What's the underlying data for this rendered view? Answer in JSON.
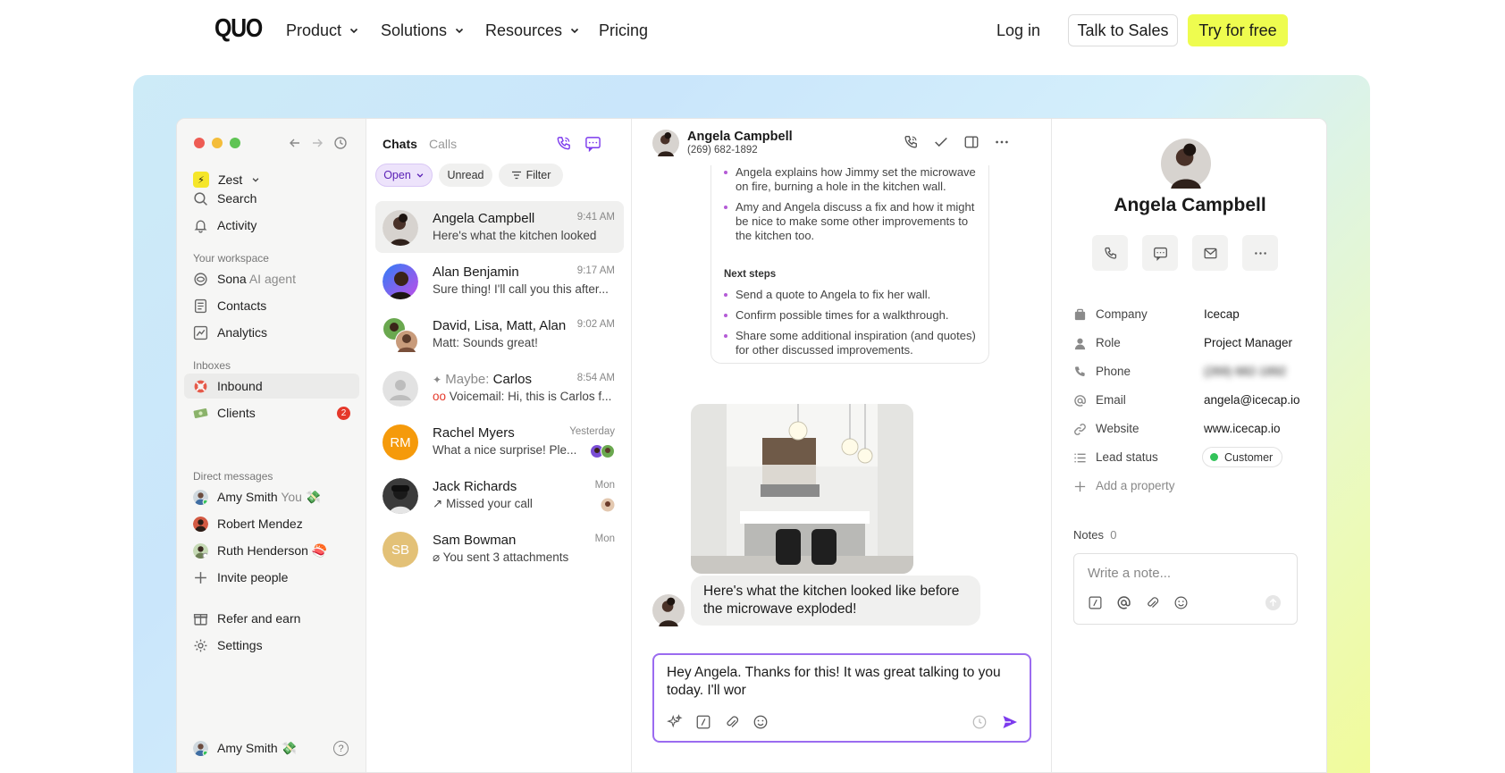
{
  "topnav": {
    "logo": "QUO",
    "items": [
      "Product",
      "Solutions",
      "Resources",
      "Pricing"
    ],
    "login": "Log in",
    "sales": "Talk to Sales",
    "try": "Try for free",
    "accent": "#eefc4f"
  },
  "sidebar": {
    "workspace": "Zest",
    "search": "Search",
    "activity": "Activity",
    "workspace_head": "Your workspace",
    "sona": "Sona",
    "sona_sub": "AI agent",
    "contacts": "Contacts",
    "analytics": "Analytics",
    "inboxes_head": "Inboxes",
    "inbound": "Inbound",
    "clients": "Clients",
    "clients_badge": "2",
    "dm_head": "Direct messages",
    "dms": [
      {
        "name": "Amy Smith",
        "suffix": "You"
      },
      {
        "name": "Robert Mendez"
      },
      {
        "name": "Ruth Henderson"
      }
    ],
    "invite": "Invite people",
    "refer": "Refer and earn",
    "settings": "Settings",
    "footer_user": "Amy Smith",
    "help": "?"
  },
  "chatlist": {
    "tabs": [
      "Chats",
      "Calls"
    ],
    "filters": [
      "Open",
      "Unread",
      "Filter"
    ],
    "items": [
      {
        "name": "Angela Campbell",
        "time": "9:41 AM",
        "preview": "Here's what the kitchen looked"
      },
      {
        "name": "Alan Benjamin",
        "time": "9:17 AM",
        "preview": "Sure thing! I'll call you this after..."
      },
      {
        "name": "David, Lisa, Matt, Alan",
        "time": "9:02 AM",
        "preview": "Matt: Sounds great!"
      },
      {
        "name_prefix": "Maybe:",
        "name": "Carlos",
        "time": "8:54 AM",
        "preview": "Voicemail: Hi, this is Carlos f..."
      },
      {
        "name": "Rachel Myers",
        "time": "Yesterday",
        "preview": "What a nice surprise! Ple...",
        "initials": "RM"
      },
      {
        "name": "Jack Richards",
        "time": "Mon",
        "preview": "Missed your call"
      },
      {
        "name": "Sam Bowman",
        "time": "Mon",
        "preview": "You sent 3 attachments",
        "initials": "SB"
      }
    ]
  },
  "conversation": {
    "contact_name": "Angela Campbell",
    "contact_phone": "(269) 682-1892",
    "summary_bullets": [
      "Angela explains how Jimmy set the microwave on fire, burning a hole in the kitchen wall.",
      "Amy and Angela discuss a fix and how it might be nice to make some other improvements to the kitchen too."
    ],
    "next_steps_head": "Next steps",
    "next_steps": [
      "Send a quote to Angela to fix her wall.",
      "Confirm possible times for a walkthrough.",
      "Share some additional inspiration (and quotes) for other discussed improvements."
    ],
    "message": "Here's what the kitchen looked like before the microwave exploded!",
    "draft": "Hey Angela. Thanks for this! It was great talking to you today. I'll wor"
  },
  "panel": {
    "name": "Angela Campbell",
    "properties": [
      {
        "label": "Company",
        "value": "Icecap",
        "icon": "building-icon"
      },
      {
        "label": "Role",
        "value": "Project Manager",
        "icon": "person-icon"
      },
      {
        "label": "Phone",
        "value": "(269) 682-1892",
        "icon": "phone-icon"
      },
      {
        "label": "Email",
        "value": "angela@icecap.io",
        "icon": "at-icon"
      },
      {
        "label": "Website",
        "value": "www.icecap.io",
        "icon": "link-icon"
      },
      {
        "label": "Lead status",
        "value": "Customer",
        "icon": "list-icon"
      }
    ],
    "add_property": "Add a property",
    "notes_label": "Notes",
    "notes_count": "0",
    "note_placeholder": "Write a note..."
  }
}
